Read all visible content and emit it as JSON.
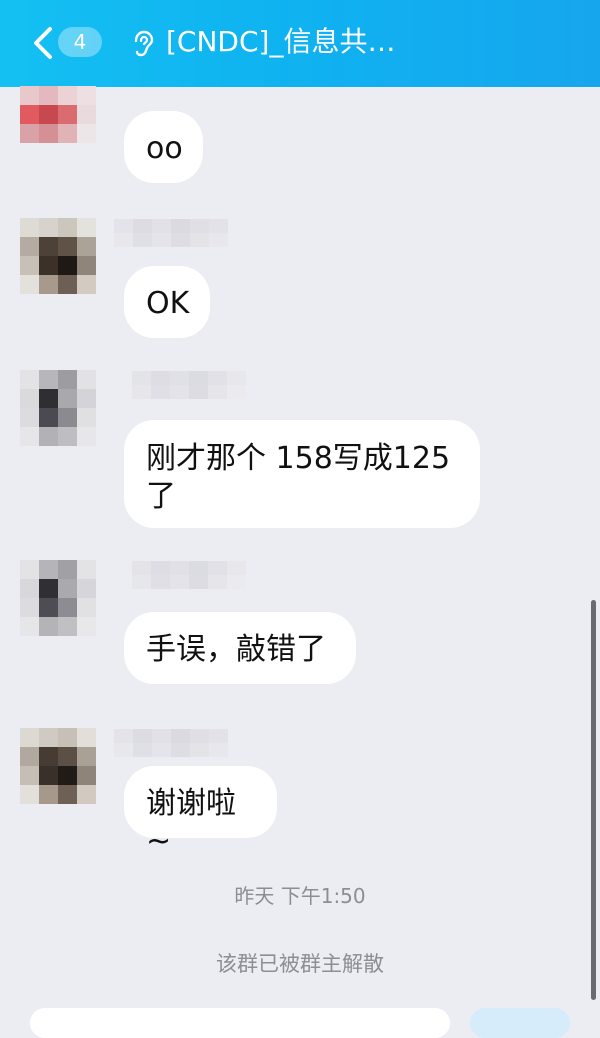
{
  "header": {
    "back_badge_count": "4",
    "title": "[CNDC]_信息共…",
    "back_icon": "chevron-left-icon",
    "listen_icon": "ear-icon",
    "background": "#12b4f0"
  },
  "messages": [
    {
      "text": "oo"
    },
    {
      "text": "OK"
    },
    {
      "text_line1": "刚才那个 158写成125",
      "text_line2": "了"
    },
    {
      "text": "手误，敲错了"
    },
    {
      "text": "谢谢啦~"
    }
  ],
  "timestamp": "昨天 下午1:50",
  "system_notice": "该群已被群主解散",
  "colors": {
    "chat_background": "#ececf3",
    "bubble": "#ffffff",
    "meta_text": "#8d8d93"
  }
}
